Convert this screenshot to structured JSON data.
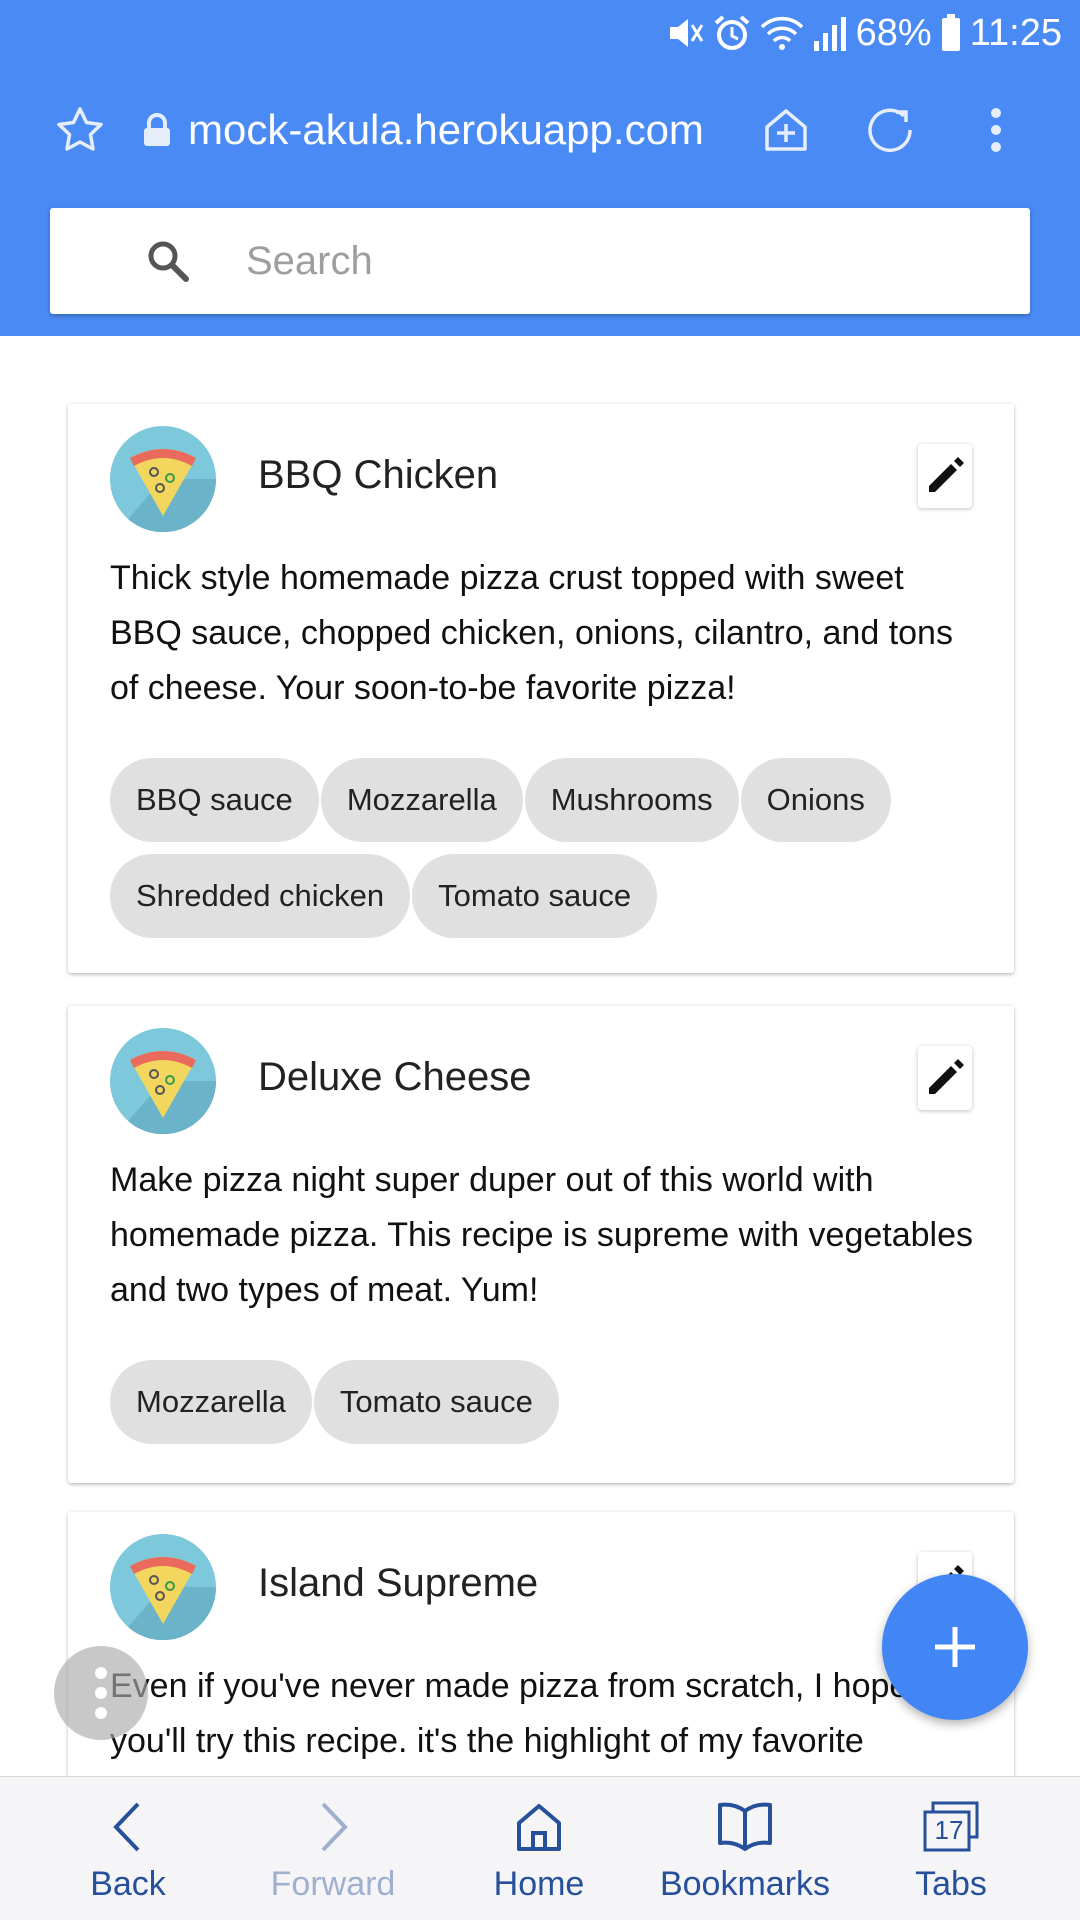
{
  "status_bar": {
    "battery": "68%",
    "time": "11:25"
  },
  "browser": {
    "url": "mock-akula.herokuapp.com",
    "icons": [
      "star-icon",
      "lock-icon",
      "add-to-home-icon",
      "reload-icon",
      "more-vert-icon"
    ]
  },
  "search": {
    "placeholder": "Search"
  },
  "cards": [
    {
      "title": "BBQ Chicken",
      "description": "Thick style homemade pizza crust topped with sweet BBQ sauce, chopped chicken, onions, cilantro, and tons of cheese. Your soon-to-be favorite pizza!",
      "tags": [
        "BBQ sauce",
        "Mozzarella",
        "Mushrooms",
        "Onions",
        "Shredded chicken",
        "Tomato sauce"
      ]
    },
    {
      "title": "Deluxe Cheese",
      "description": "Make pizza night super duper out of this world with homemade pizza. This recipe is supreme with vegetables and two types of meat. Yum!",
      "tags": [
        "Mozzarella",
        "Tomato sauce"
      ]
    },
    {
      "title": "Island Supreme",
      "description": "Even if you've never made pizza from scratch, I hope you'll try this recipe. it's the highlight of my favorite"
    }
  ],
  "bottom_nav": {
    "back": "Back",
    "forward": "Forward",
    "home": "Home",
    "bookmarks": "Bookmarks",
    "tabs": "Tabs",
    "tab_count": "17"
  },
  "colors": {
    "toolbar": "#4a8af4",
    "fab": "#4286f5",
    "nav_text": "#27509b",
    "chip": "#e0e0e0",
    "avatar_bg": "#7ec8dc"
  }
}
